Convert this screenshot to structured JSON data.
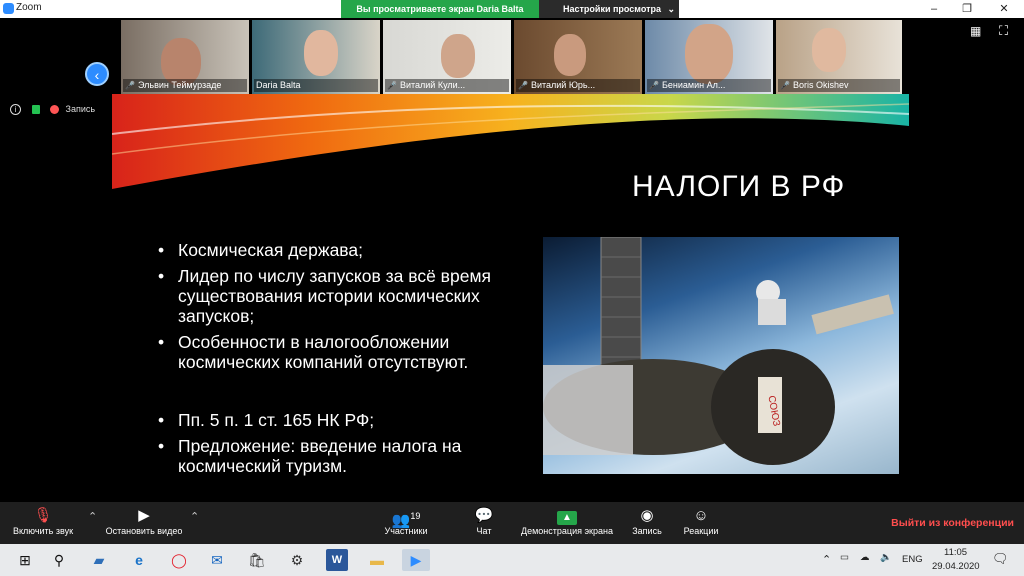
{
  "window": {
    "app_title": "Zoom",
    "sharing_banner": "Вы просматриваете экран Daria Balta",
    "view_options": "Настройки просмотра"
  },
  "participants": [
    {
      "name": "Эльвин Теймурзаде",
      "muted": true
    },
    {
      "name": "Daria Balta",
      "muted": false
    },
    {
      "name": "Виталий Кули...",
      "muted": true
    },
    {
      "name": "Виталий Юрь...",
      "muted": true
    },
    {
      "name": "Бениамин Ал...",
      "muted": true
    },
    {
      "name": "Boris Okishev",
      "muted": true
    }
  ],
  "meeting_status": {
    "recording_label": "Запись"
  },
  "slide": {
    "title": "НАЛОГИ В РФ",
    "bullets": [
      "Космическая держава;",
      "Лидер по числу запусков за всё время существования истории космических запусков;",
      "Особенности в налогообложении космических компаний отсутствуют."
    ],
    "bullets2": [
      "Пп. 5 п. 1 ст. 165 НК РФ;",
      "Предложение: введение налога на космический туризм."
    ],
    "image_label": "СОЮЗ"
  },
  "toolbar": {
    "mute": "Включить звук",
    "video": "Остановить видео",
    "participants": "Участники",
    "participants_count": "19",
    "chat": "Чат",
    "share": "Демонстрация экрана",
    "record": "Запись",
    "reactions": "Реакции",
    "leave": "Выйти из конференции"
  },
  "taskbar": {
    "lang": "ENG",
    "time": "11:05",
    "date": "29.04.2020"
  },
  "colors": {
    "zoom_blue": "#2d8cff",
    "share_green": "#25a64a",
    "leave_red": "#ff4e4e"
  }
}
